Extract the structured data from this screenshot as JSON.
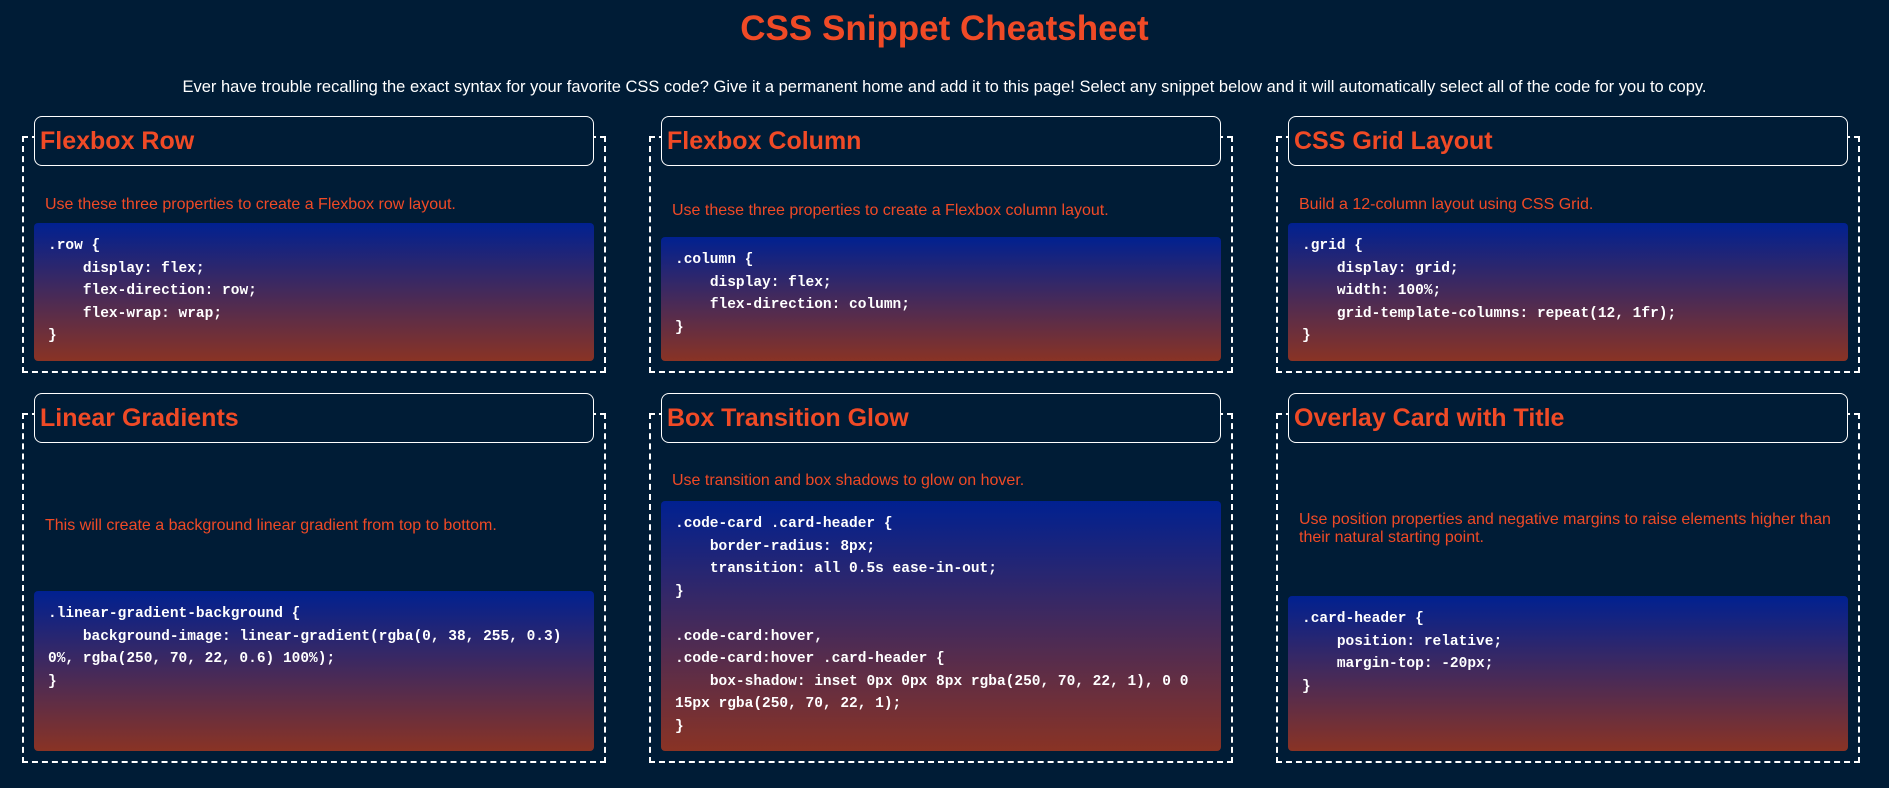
{
  "page": {
    "title": "CSS Snippet Cheatsheet",
    "intro": "Ever have trouble recalling the exact syntax for your favorite CSS code? Give it a permanent home and add it to this page! Select any snippet below and it will automatically select all of the code for you to copy."
  },
  "colors": {
    "background": "#001c36",
    "accent": "#f04a26",
    "gradient_top": "rgba(0, 38, 255, 0.3)",
    "gradient_bottom": "rgba(250, 70, 22, 0.6)"
  },
  "cards": [
    {
      "title": "Flexbox Row",
      "description": "Use these three properties to create a Flexbox row layout.",
      "code": ".row {\n    display: flex;\n    flex-direction: row;\n    flex-wrap: wrap;\n}"
    },
    {
      "title": "Flexbox Column",
      "description": "Use these three properties to create a Flexbox column layout.",
      "code": ".column {\n    display: flex;\n    flex-direction: column;\n}"
    },
    {
      "title": "CSS Grid Layout",
      "description": "Build a 12-column layout using CSS Grid.",
      "code": ".grid {\n    display: grid;\n    width: 100%;\n    grid-template-columns: repeat(12, 1fr);\n}"
    },
    {
      "title": "Linear Gradients",
      "description": "This will create a background linear gradient from top to bottom.",
      "code": ".linear-gradient-background {\n    background-image: linear-gradient(rgba(0, 38, 255, 0.3) 0%, rgba(250, 70, 22, 0.6) 100%);\n}"
    },
    {
      "title": "Box Transition Glow",
      "description": "Use transition and box shadows to glow on hover.",
      "code": ".code-card .card-header {\n    border-radius: 8px;\n    transition: all 0.5s ease-in-out;\n}\n\n.code-card:hover,\n.code-card:hover .card-header {\n    box-shadow: inset 0px 0px 8px rgba(250, 70, 22, 1), 0 0 15px rgba(250, 70, 22, 1);\n}"
    },
    {
      "title": "Overlay Card with Title",
      "description": "Use position properties and negative margins to raise elements higher than their natural starting point.",
      "code": ".card-header {\n    position: relative;\n    margin-top: -20px;\n}"
    }
  ]
}
